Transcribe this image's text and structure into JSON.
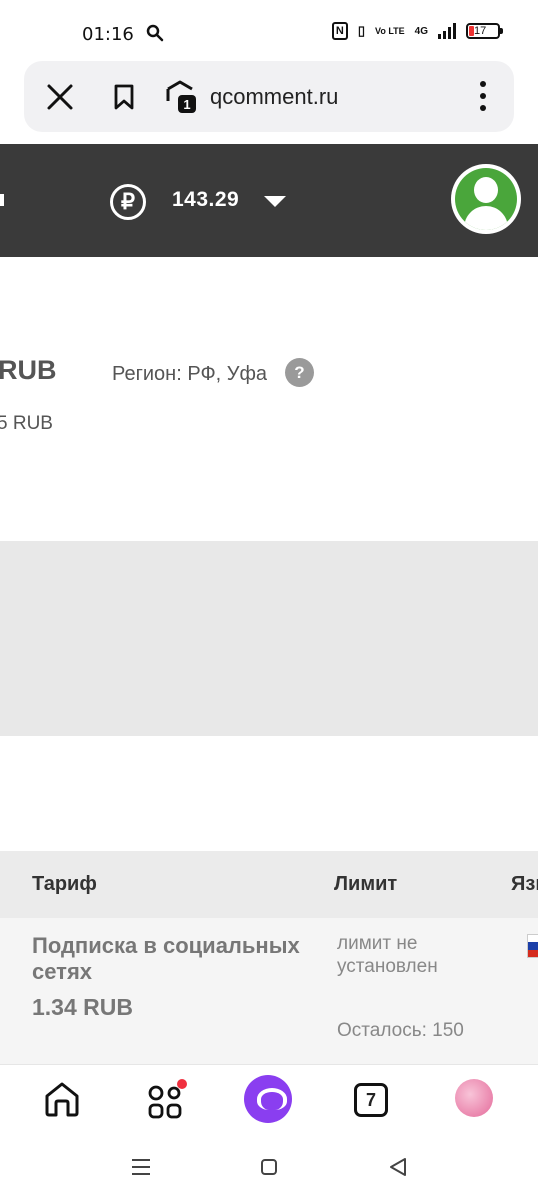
{
  "status_bar": {
    "time": "01:16",
    "network_label": "4G",
    "volte_label": "Vo LTE",
    "battery_level": "17"
  },
  "browser": {
    "url": "qcomment.ru",
    "tab_badge": "1"
  },
  "header": {
    "currency_symbol": "₽",
    "balance": "143.29"
  },
  "info": {
    "rub_fragment": "RUB",
    "region_text": "Регион: РФ, Уфа",
    "help_symbol": "?",
    "rub_fragment_2": "5 RUB"
  },
  "table": {
    "headers": {
      "tariff": "Тариф",
      "limit": "Лимит",
      "language": "Язы"
    },
    "rows": [
      {
        "tariff_name": "Подписка в социальных сетях",
        "price": "1.34 RUB",
        "limit": "лимит не установлен",
        "remaining": "Осталось: 150"
      }
    ]
  },
  "bottom_nav": {
    "tabs_count": "7"
  },
  "colors": {
    "header_bg": "#3a3a3a",
    "avatar_green": "#4aa63b",
    "alice_purple": "#8a3ef0",
    "notification_red": "#f0303f"
  }
}
